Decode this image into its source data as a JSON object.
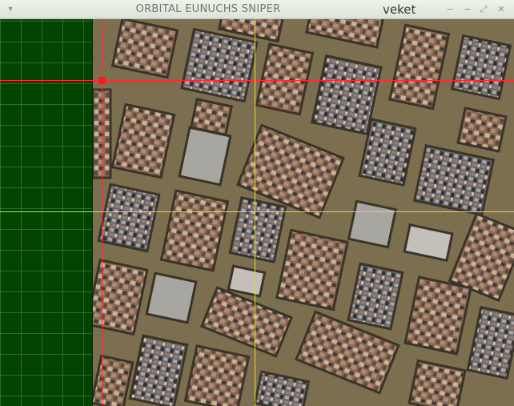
{
  "window": {
    "title": "ORBITAL EUNUCHS SNIPER",
    "user": "veket",
    "controls": {
      "menu_glyph": "▾",
      "minimize_glyph": "−",
      "restore_glyph": "⤢",
      "close_glyph": "✕"
    }
  },
  "scene": {
    "grid_color": "#004400",
    "map_ground_color": "#7c6f50",
    "red_crosshair_color": "#ff2a2a",
    "yellow_crosshair_color": "#e8d82a",
    "icons": {
      "menu": "chevron-down-icon",
      "minimize": "minimize-icon",
      "restore": "maximize-icon",
      "close": "close-icon",
      "target": "target-marker-icon"
    }
  }
}
